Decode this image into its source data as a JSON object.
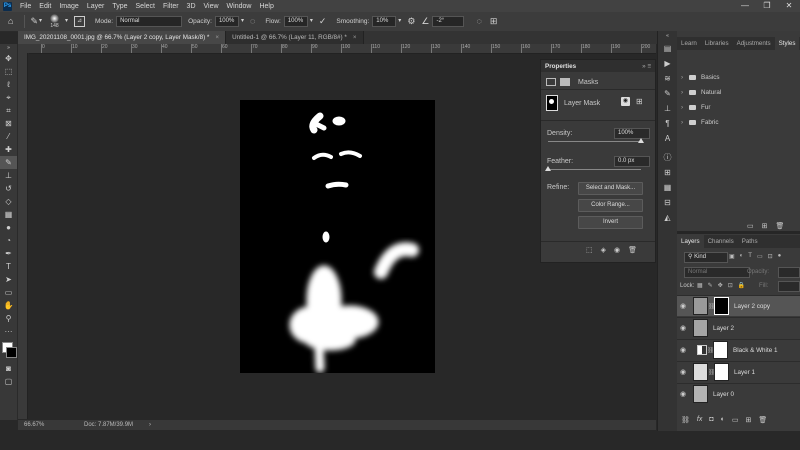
{
  "app": {
    "logo": "Ps"
  },
  "menu": [
    "File",
    "Edit",
    "Image",
    "Layer",
    "Type",
    "Select",
    "Filter",
    "3D",
    "View",
    "Window",
    "Help"
  ],
  "window_controls": [
    "—",
    "❐",
    "✕"
  ],
  "options": {
    "brush_size": "148",
    "mode_label": "Mode:",
    "mode_value": "Normal",
    "opacity_label": "Opacity:",
    "opacity_value": "100%",
    "flow_label": "Flow:",
    "flow_value": "100%",
    "smoothing_label": "Smoothing:",
    "smoothing_value": "10%",
    "angle_value": "-2°"
  },
  "tabs": [
    {
      "label": "IMG_20201108_0001.jpg @ 66.7% (Layer 2 copy, Layer Mask/8) *",
      "close": "×"
    },
    {
      "label": "Untitled-1 @ 66.7% (Layer 11, RGB/8#) *",
      "close": "×"
    }
  ],
  "ruler_ticks": [
    "0",
    "10",
    "20",
    "30",
    "40",
    "50",
    "60",
    "70",
    "80",
    "90",
    "100",
    "110",
    "120",
    "130",
    "140",
    "150",
    "160",
    "170",
    "180",
    "190",
    "200"
  ],
  "status": {
    "zoom": "66.67%",
    "doc": "Doc: 7.87M/39.9M",
    "arrow": "›"
  },
  "properties": {
    "title": "Properties",
    "section": "Masks",
    "mask_label": "Layer Mask",
    "density_label": "Density:",
    "density_value": "100%",
    "density_level": 1.0,
    "feather_label": "Feather:",
    "feather_value": "0.0 px",
    "feather_level": 0.0,
    "refine_label": "Refine:",
    "btn_select_mask": "Select and Mask...",
    "btn_color_range": "Color Range...",
    "btn_invert": "Invert"
  },
  "styles_panel": {
    "tabs": [
      "Learn",
      "Libraries",
      "Adjustments",
      "Styles"
    ],
    "folders": [
      "Basics",
      "Natural",
      "Fur",
      "Fabric"
    ]
  },
  "layers_panel": {
    "tabs": [
      "Layers",
      "Channels",
      "Paths"
    ],
    "kind_label": "Kind",
    "blend_mode": "Normal",
    "opacity_label": "Opacity:",
    "lock_label": "Lock:",
    "fill_label": "Fill:",
    "layers": [
      {
        "name": "Layer 2 copy",
        "selected": true
      },
      {
        "name": "Layer 2",
        "selected": false
      },
      {
        "name": "Black & White 1",
        "selected": false
      },
      {
        "name": "Layer 1",
        "selected": false
      },
      {
        "name": "Layer 0",
        "selected": false
      }
    ],
    "footer_icons": [
      "link-icon",
      "fx-icon",
      "mask-icon",
      "adjustment-icon",
      "folder-icon",
      "new-layer-icon",
      "trash-icon"
    ]
  },
  "colors": {
    "accent": "#31a8ff",
    "panel": "#3a3a3a",
    "canvas": "#282828"
  }
}
